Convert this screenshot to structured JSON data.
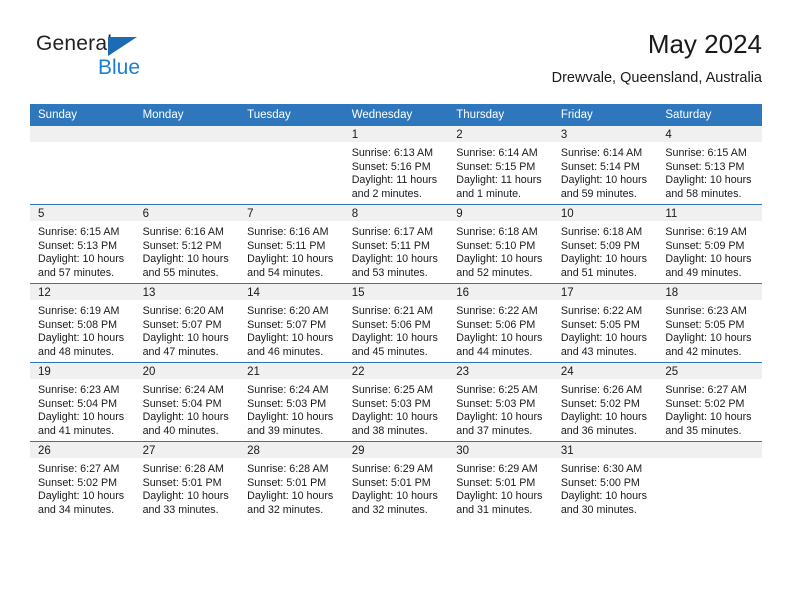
{
  "brand": {
    "name_top": "General",
    "name_bottom": "Blue",
    "accent_color": "#1b7fd4",
    "triangle_color": "#1b6cb3"
  },
  "header": {
    "title": "May 2024",
    "location": "Drewvale, Queensland, Australia"
  },
  "calendar": {
    "header_bg": "#2f77bc",
    "daynum_bg": "#f0f0f0",
    "weekday_headers": [
      "Sunday",
      "Monday",
      "Tuesday",
      "Wednesday",
      "Thursday",
      "Friday",
      "Saturday"
    ],
    "weeks": [
      [
        {
          "day": "",
          "sunrise": "",
          "sunset": "",
          "daylight": "",
          "daylight2": ""
        },
        {
          "day": "",
          "sunrise": "",
          "sunset": "",
          "daylight": "",
          "daylight2": ""
        },
        {
          "day": "",
          "sunrise": "",
          "sunset": "",
          "daylight": "",
          "daylight2": ""
        },
        {
          "day": "1",
          "sunrise": "Sunrise: 6:13 AM",
          "sunset": "Sunset: 5:16 PM",
          "daylight": "Daylight: 11 hours",
          "daylight2": "and 2 minutes."
        },
        {
          "day": "2",
          "sunrise": "Sunrise: 6:14 AM",
          "sunset": "Sunset: 5:15 PM",
          "daylight": "Daylight: 11 hours",
          "daylight2": "and 1 minute."
        },
        {
          "day": "3",
          "sunrise": "Sunrise: 6:14 AM",
          "sunset": "Sunset: 5:14 PM",
          "daylight": "Daylight: 10 hours",
          "daylight2": "and 59 minutes."
        },
        {
          "day": "4",
          "sunrise": "Sunrise: 6:15 AM",
          "sunset": "Sunset: 5:13 PM",
          "daylight": "Daylight: 10 hours",
          "daylight2": "and 58 minutes."
        }
      ],
      [
        {
          "day": "5",
          "sunrise": "Sunrise: 6:15 AM",
          "sunset": "Sunset: 5:13 PM",
          "daylight": "Daylight: 10 hours",
          "daylight2": "and 57 minutes."
        },
        {
          "day": "6",
          "sunrise": "Sunrise: 6:16 AM",
          "sunset": "Sunset: 5:12 PM",
          "daylight": "Daylight: 10 hours",
          "daylight2": "and 55 minutes."
        },
        {
          "day": "7",
          "sunrise": "Sunrise: 6:16 AM",
          "sunset": "Sunset: 5:11 PM",
          "daylight": "Daylight: 10 hours",
          "daylight2": "and 54 minutes."
        },
        {
          "day": "8",
          "sunrise": "Sunrise: 6:17 AM",
          "sunset": "Sunset: 5:11 PM",
          "daylight": "Daylight: 10 hours",
          "daylight2": "and 53 minutes."
        },
        {
          "day": "9",
          "sunrise": "Sunrise: 6:18 AM",
          "sunset": "Sunset: 5:10 PM",
          "daylight": "Daylight: 10 hours",
          "daylight2": "and 52 minutes."
        },
        {
          "day": "10",
          "sunrise": "Sunrise: 6:18 AM",
          "sunset": "Sunset: 5:09 PM",
          "daylight": "Daylight: 10 hours",
          "daylight2": "and 51 minutes."
        },
        {
          "day": "11",
          "sunrise": "Sunrise: 6:19 AM",
          "sunset": "Sunset: 5:09 PM",
          "daylight": "Daylight: 10 hours",
          "daylight2": "and 49 minutes."
        }
      ],
      [
        {
          "day": "12",
          "sunrise": "Sunrise: 6:19 AM",
          "sunset": "Sunset: 5:08 PM",
          "daylight": "Daylight: 10 hours",
          "daylight2": "and 48 minutes."
        },
        {
          "day": "13",
          "sunrise": "Sunrise: 6:20 AM",
          "sunset": "Sunset: 5:07 PM",
          "daylight": "Daylight: 10 hours",
          "daylight2": "and 47 minutes."
        },
        {
          "day": "14",
          "sunrise": "Sunrise: 6:20 AM",
          "sunset": "Sunset: 5:07 PM",
          "daylight": "Daylight: 10 hours",
          "daylight2": "and 46 minutes."
        },
        {
          "day": "15",
          "sunrise": "Sunrise: 6:21 AM",
          "sunset": "Sunset: 5:06 PM",
          "daylight": "Daylight: 10 hours",
          "daylight2": "and 45 minutes."
        },
        {
          "day": "16",
          "sunrise": "Sunrise: 6:22 AM",
          "sunset": "Sunset: 5:06 PM",
          "daylight": "Daylight: 10 hours",
          "daylight2": "and 44 minutes."
        },
        {
          "day": "17",
          "sunrise": "Sunrise: 6:22 AM",
          "sunset": "Sunset: 5:05 PM",
          "daylight": "Daylight: 10 hours",
          "daylight2": "and 43 minutes."
        },
        {
          "day": "18",
          "sunrise": "Sunrise: 6:23 AM",
          "sunset": "Sunset: 5:05 PM",
          "daylight": "Daylight: 10 hours",
          "daylight2": "and 42 minutes."
        }
      ],
      [
        {
          "day": "19",
          "sunrise": "Sunrise: 6:23 AM",
          "sunset": "Sunset: 5:04 PM",
          "daylight": "Daylight: 10 hours",
          "daylight2": "and 41 minutes."
        },
        {
          "day": "20",
          "sunrise": "Sunrise: 6:24 AM",
          "sunset": "Sunset: 5:04 PM",
          "daylight": "Daylight: 10 hours",
          "daylight2": "and 40 minutes."
        },
        {
          "day": "21",
          "sunrise": "Sunrise: 6:24 AM",
          "sunset": "Sunset: 5:03 PM",
          "daylight": "Daylight: 10 hours",
          "daylight2": "and 39 minutes."
        },
        {
          "day": "22",
          "sunrise": "Sunrise: 6:25 AM",
          "sunset": "Sunset: 5:03 PM",
          "daylight": "Daylight: 10 hours",
          "daylight2": "and 38 minutes."
        },
        {
          "day": "23",
          "sunrise": "Sunrise: 6:25 AM",
          "sunset": "Sunset: 5:03 PM",
          "daylight": "Daylight: 10 hours",
          "daylight2": "and 37 minutes."
        },
        {
          "day": "24",
          "sunrise": "Sunrise: 6:26 AM",
          "sunset": "Sunset: 5:02 PM",
          "daylight": "Daylight: 10 hours",
          "daylight2": "and 36 minutes."
        },
        {
          "day": "25",
          "sunrise": "Sunrise: 6:27 AM",
          "sunset": "Sunset: 5:02 PM",
          "daylight": "Daylight: 10 hours",
          "daylight2": "and 35 minutes."
        }
      ],
      [
        {
          "day": "26",
          "sunrise": "Sunrise: 6:27 AM",
          "sunset": "Sunset: 5:02 PM",
          "daylight": "Daylight: 10 hours",
          "daylight2": "and 34 minutes."
        },
        {
          "day": "27",
          "sunrise": "Sunrise: 6:28 AM",
          "sunset": "Sunset: 5:01 PM",
          "daylight": "Daylight: 10 hours",
          "daylight2": "and 33 minutes."
        },
        {
          "day": "28",
          "sunrise": "Sunrise: 6:28 AM",
          "sunset": "Sunset: 5:01 PM",
          "daylight": "Daylight: 10 hours",
          "daylight2": "and 32 minutes."
        },
        {
          "day": "29",
          "sunrise": "Sunrise: 6:29 AM",
          "sunset": "Sunset: 5:01 PM",
          "daylight": "Daylight: 10 hours",
          "daylight2": "and 32 minutes."
        },
        {
          "day": "30",
          "sunrise": "Sunrise: 6:29 AM",
          "sunset": "Sunset: 5:01 PM",
          "daylight": "Daylight: 10 hours",
          "daylight2": "and 31 minutes."
        },
        {
          "day": "31",
          "sunrise": "Sunrise: 6:30 AM",
          "sunset": "Sunset: 5:00 PM",
          "daylight": "Daylight: 10 hours",
          "daylight2": "and 30 minutes."
        },
        {
          "day": "",
          "sunrise": "",
          "sunset": "",
          "daylight": "",
          "daylight2": ""
        }
      ]
    ]
  }
}
